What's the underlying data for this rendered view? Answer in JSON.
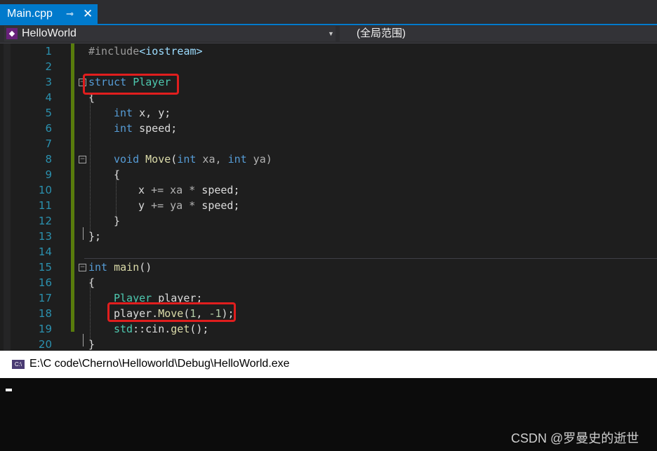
{
  "tab": {
    "title": "Main.cpp",
    "pin": "⊸",
    "close": "✕",
    "active_color": "#007acc"
  },
  "navbar": {
    "project": "HelloWorld",
    "scope": "(全局范围)"
  },
  "editor": {
    "line_numbers": [
      "1",
      "2",
      "3",
      "4",
      "5",
      "6",
      "7",
      "8",
      "9",
      "10",
      "11",
      "12",
      "13",
      "14",
      "15",
      "16",
      "17",
      "18",
      "19",
      "20"
    ],
    "code": {
      "l1_a": "#include",
      "l1_b": "<iostream>",
      "l3_a": "struct",
      "l3_b": " Player",
      "l4": "{",
      "l5_a": "int",
      "l5_b": " x, y;",
      "l6_a": "int",
      "l6_b": " speed;",
      "l8_a": "void",
      "l8_b": " Move",
      "l8_c": "(",
      "l8_d": "int",
      "l8_e": " xa, ",
      "l8_f": "int",
      "l8_g": " ya)",
      "l9": "{",
      "l10_a": "x ",
      "l10_b": "+=",
      "l10_c": " xa ",
      "l10_d": "*",
      "l10_e": " speed;",
      "l11_a": "y ",
      "l11_b": "+=",
      "l11_c": " ya ",
      "l11_d": "*",
      "l11_e": " speed;",
      "l12": "}",
      "l13": "};",
      "l15_a": "int",
      "l15_b": " main",
      "l15_c": "()",
      "l16": "{",
      "l17_a": "Player",
      "l17_b": " player;",
      "l18_a": "player.",
      "l18_b": "Move",
      "l18_c": "(",
      "l18_d": "1",
      "l18_e": ", ",
      "l18_f": "-1",
      "l18_g": ");",
      "l19_a": "std",
      "l19_b": "::",
      "l19_c": "cin.",
      "l19_d": "get",
      "l19_e": "();",
      "l20": "}"
    },
    "fold_glyph": "⊟",
    "highlight_color": "#e01e1e"
  },
  "console": {
    "title": "E:\\C code\\Cherno\\Helloworld\\Debug\\HelloWorld.exe",
    "icon_text": "C:\\"
  },
  "watermark": "CSDN @罗曼史的逝世"
}
